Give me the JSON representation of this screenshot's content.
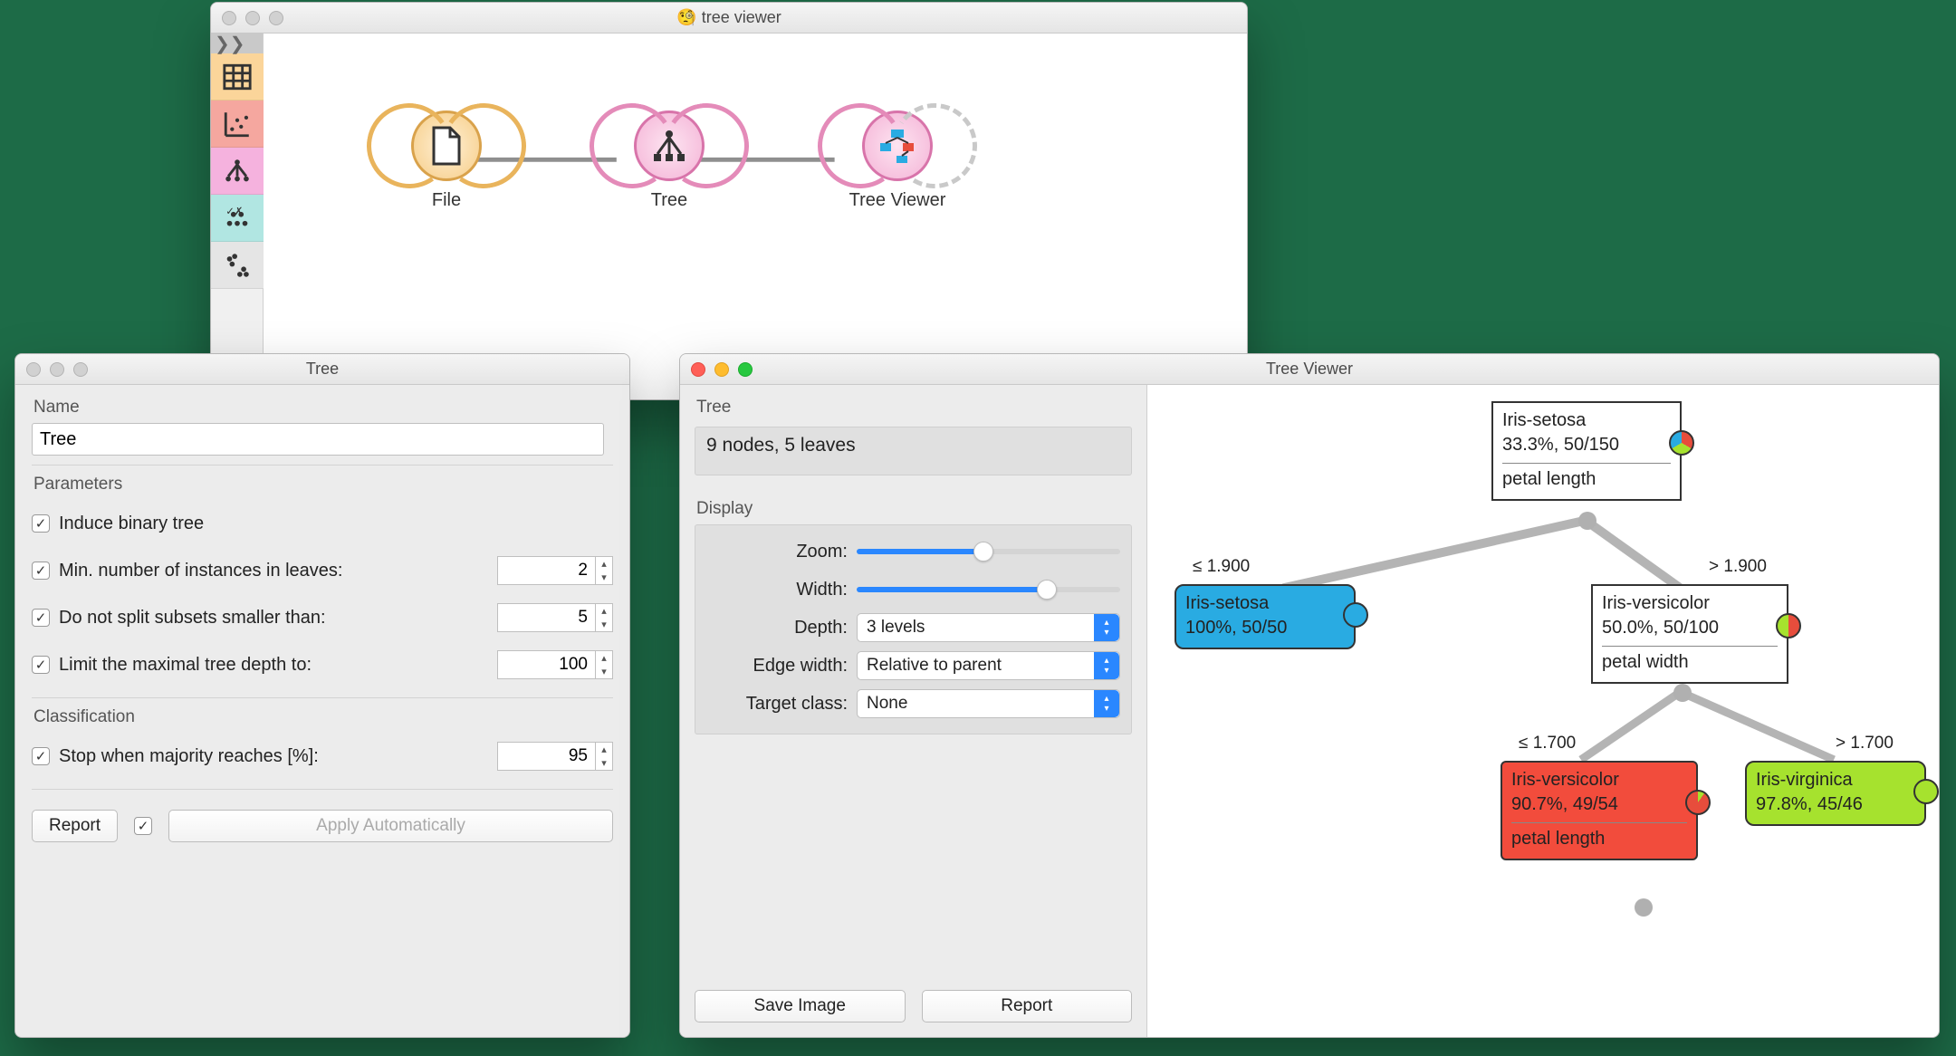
{
  "canvas": {
    "title": "tree viewer",
    "nodes": [
      {
        "label": "File"
      },
      {
        "label": "Tree"
      },
      {
        "label": "Tree Viewer"
      }
    ]
  },
  "tree_settings": {
    "title": "Tree",
    "name_section": "Name",
    "name_value": "Tree",
    "params_section": "Parameters",
    "induce_binary": "Induce binary tree",
    "min_instances_label": "Min. number of instances in leaves:",
    "min_instances_value": "2",
    "no_split_label": "Do not split subsets smaller than:",
    "no_split_value": "5",
    "max_depth_label": "Limit the maximal tree depth to:",
    "max_depth_value": "100",
    "classification_section": "Classification",
    "majority_label": "Stop when majority reaches [%]:",
    "majority_value": "95",
    "report_btn": "Report",
    "apply_btn": "Apply Automatically"
  },
  "viewer": {
    "title": "Tree Viewer",
    "info_title": "Tree",
    "info_text": "9 nodes, 5 leaves",
    "display_section": "Display",
    "zoom_label": "Zoom:",
    "width_label": "Width:",
    "depth_label": "Depth:",
    "depth_value": "3 levels",
    "edge_label": "Edge width:",
    "edge_value": "Relative to parent",
    "target_label": "Target class:",
    "target_value": "None",
    "save_btn": "Save Image",
    "report_btn": "Report",
    "diagram": {
      "root": {
        "line1": "Iris-setosa",
        "line2": "33.3%, 50/150",
        "split": "petal length"
      },
      "edge_l": "≤ 1.900",
      "edge_r": "> 1.900",
      "leaf_l": {
        "line1": "Iris-setosa",
        "line2": "100%, 50/50"
      },
      "mid": {
        "line1": "Iris-versicolor",
        "line2": "50.0%, 50/100",
        "split": "petal width"
      },
      "edge_ml": "≤ 1.700",
      "edge_mr": "> 1.700",
      "leaf_ml": {
        "line1": "Iris-versicolor",
        "line2": "90.7%, 49/54",
        "split": "petal length"
      },
      "leaf_mr": {
        "line1": "Iris-virginica",
        "line2": "97.8%, 45/46"
      }
    }
  }
}
